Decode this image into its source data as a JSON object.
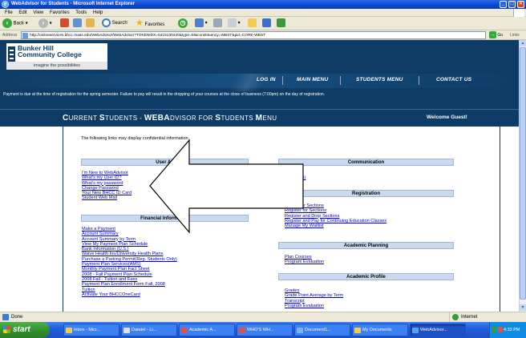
{
  "window": {
    "title": "WebAdvisor for Students - Microsoft Internet Explorer"
  },
  "menubar": {
    "items": [
      "File",
      "Edit",
      "View",
      "Favorites",
      "Tools",
      "Help"
    ]
  },
  "toolbar": {
    "back": "Back",
    "search": "Search",
    "favorites": "Favorites"
  },
  "address": {
    "label": "Address",
    "url": "http://onlineservices.bhcc.mass.edu/WebAdvisor/WebAdvisor?TOKENIDX=5415130420&type=M&constituency=WBST&pid=CORE-WBST",
    "go": "Go",
    "links": "Links"
  },
  "page": {
    "logo": {
      "line1": "Bunker Hill",
      "line2": "Community College",
      "tagline": "imagine the possibilities"
    },
    "nav": [
      "LOG IN",
      "MAIN MENU",
      "STUDENTS MENU",
      "CONTACT US"
    ],
    "notice": "Payment is due at the time of registration for the spring semester. Failure to pay will result in the dropping of your courses at the close of business (7:00pm) on the day of registration.",
    "title_parts": [
      "C",
      "URRENT ",
      "S",
      "TUDENTS - ",
      "WEBA",
      "DVISOR FOR ",
      "S",
      "TUDENTS ",
      "M",
      "ENU"
    ],
    "welcome": "Welcome Guest!",
    "intro": "The following links may display confidential information.",
    "sections": {
      "user_account": {
        "title": "User Ac",
        "links": [
          "I'm New to WebAdvisor",
          "What's my User ID?",
          "What's my password",
          "Change Password",
          "Your New BHCC ID Card",
          "Student Web Mail"
        ]
      },
      "financial": {
        "title": "Financial Information",
        "links": [
          "Make a Payment",
          "Account Summary",
          "Account Summary by Term",
          "View My Payment Plan Schedule",
          "Bank Information (U.S.)",
          "Waive Health Ins/University Health Plans",
          "Purchase a Parking Permit(Reg. Students Only)",
          "Payment Plan Services(AMS)",
          "Monthly Payment Plan Fact Sheet",
          "2008 - Fall Payment Plan Schedule",
          "2008 Fall - Tuition and Fees",
          "Payment Plan Enrollment Form Fall, 2008",
          "Tuition",
          "Activate Your BHCCOneCard"
        ]
      },
      "communication": {
        "title": "Communication",
        "links": [
          "rs",
          "visor(s)"
        ]
      },
      "registration": {
        "title": "Registration",
        "links": [
          "Search for Sections",
          "Register for Sections",
          "Register and Drop Sections",
          "Register and Pay for Continuing Education Classes",
          "Manage My Waitlist"
        ]
      },
      "academic_planning": {
        "title": "Academic Planning",
        "links": [
          "Plan Courses",
          "Program Evaluation"
        ]
      },
      "academic_profile": {
        "title": "Academic Profile",
        "links": [
          "Grades",
          "Grade Point Average by Term",
          "Transcript",
          "Program Evaluation"
        ]
      }
    }
  },
  "status": {
    "text": "Done",
    "zone": "Internet"
  },
  "taskbar": {
    "start": "start",
    "tasks": [
      "Inbox - Micr...",
      "Datatel - Li...",
      "Academic A...",
      "WHO'S WH...",
      "Document1...",
      "My Documents",
      "WebAdvisor..."
    ],
    "clock": "4:33 PM"
  }
}
